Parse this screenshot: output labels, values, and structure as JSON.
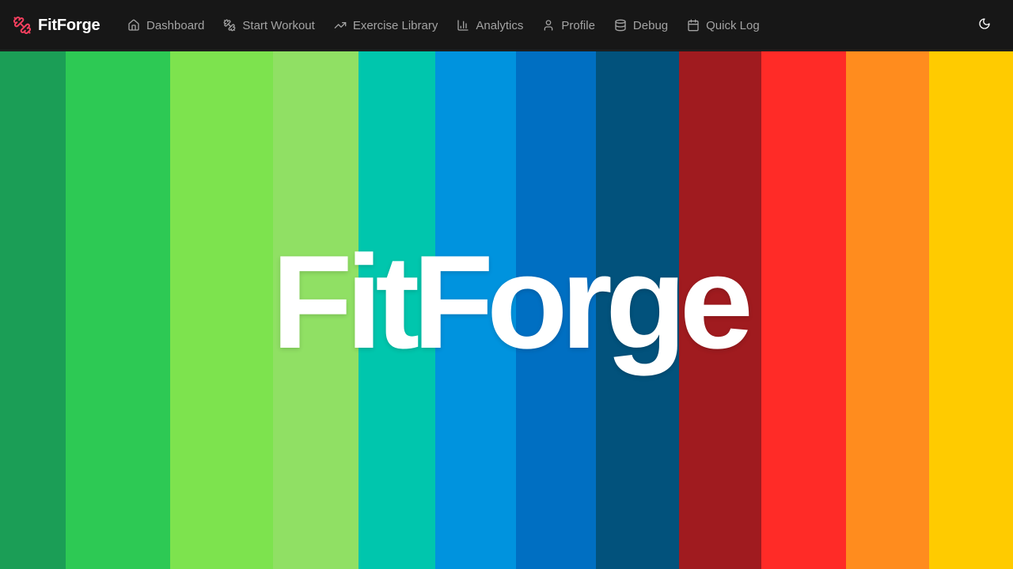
{
  "app": {
    "brand_name": "FitForge",
    "brand_icon": "dumbbell-icon",
    "brand_color": "#f43f5e"
  },
  "nav": {
    "items": [
      {
        "label": "Dashboard",
        "icon": "home-icon"
      },
      {
        "label": "Start Workout",
        "icon": "dumbbell-icon"
      },
      {
        "label": "Exercise Library",
        "icon": "trending-up-icon"
      },
      {
        "label": "Analytics",
        "icon": "bar-chart-icon"
      },
      {
        "label": "Profile",
        "icon": "user-icon"
      },
      {
        "label": "Debug",
        "icon": "database-icon"
      },
      {
        "label": "Quick Log",
        "icon": "calendar-icon"
      }
    ],
    "theme_toggle_icon": "moon-icon"
  },
  "hero": {
    "logo_text": "FitForge",
    "stripe_colors": [
      "#1b9e56",
      "#2dc954",
      "#7de34e",
      "#90e064",
      "#00c6ad",
      "#0093de",
      "#006fc2",
      "#02527c",
      "#a01b1f",
      "#ff2b27",
      "#ff8c1e",
      "#ffcb00"
    ]
  },
  "colors": {
    "navbar_bg": "#171717",
    "nav_text": "#a3a3a3",
    "brand_text": "#ffffff"
  }
}
